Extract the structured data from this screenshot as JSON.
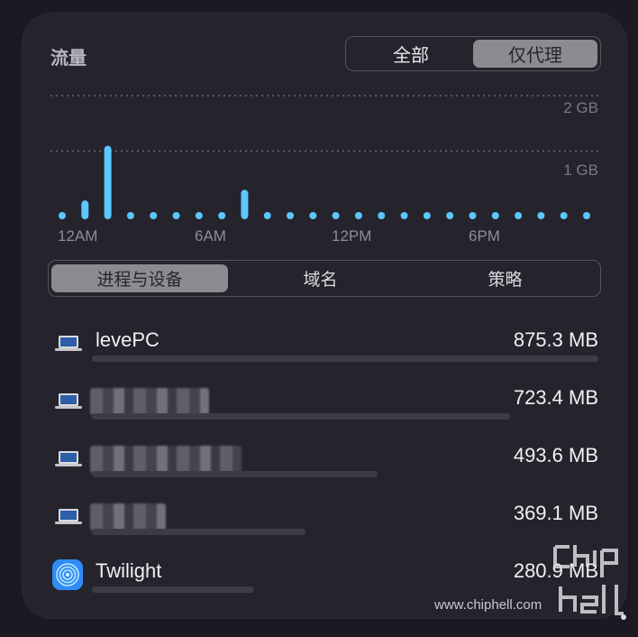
{
  "panel": {
    "title": "流量",
    "filter_tabs": [
      {
        "label": "全部",
        "active": false
      },
      {
        "label": "仅代理",
        "active": true
      }
    ],
    "category_tabs": [
      {
        "label": "进程与设备",
        "active": true
      },
      {
        "label": "域名",
        "active": false
      },
      {
        "label": "策略",
        "active": false
      }
    ]
  },
  "chart_data": {
    "type": "bar",
    "y_ticks": [
      "2 GB",
      "1 GB"
    ],
    "x_tick_labels": [
      "12AM",
      "6AM",
      "12PM",
      "6PM"
    ],
    "grid": true,
    "bar_color": "#5ac8fa",
    "values_gb": [
      0,
      0.32,
      1.25,
      0,
      0,
      0,
      0,
      0,
      0.5,
      0,
      0,
      0,
      0,
      0,
      0,
      0,
      0,
      0,
      0,
      0,
      0,
      0,
      0,
      0
    ],
    "ylim": [
      0,
      2
    ]
  },
  "devices": [
    {
      "name": "levePC",
      "value": "875.3 MB",
      "share": 1.0,
      "icon": "laptop-icon",
      "name_visible": true
    },
    {
      "name": "",
      "value": "723.4 MB",
      "share": 0.826,
      "icon": "laptop-icon",
      "name_visible": false
    },
    {
      "name": "",
      "value": "493.6 MB",
      "share": 0.564,
      "icon": "laptop-icon",
      "name_visible": false
    },
    {
      "name": "",
      "value": "369.1 MB",
      "share": 0.422,
      "icon": "laptop-icon",
      "name_visible": false
    },
    {
      "name": "Twilight",
      "value": "280.9 MB",
      "share": 0.321,
      "icon": "twilight-app-icon",
      "name_visible": true
    }
  ],
  "watermark": {
    "text": "www.chiphell.com",
    "logo": "chiphell"
  }
}
